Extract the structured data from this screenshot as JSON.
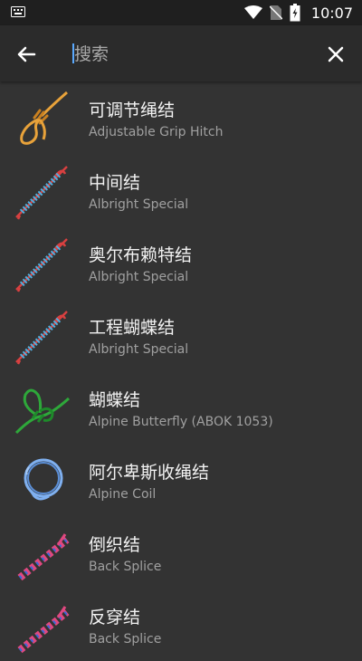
{
  "status_bar": {
    "time": "10:07"
  },
  "search": {
    "placeholder": "搜索",
    "value": ""
  },
  "knots": [
    {
      "name": "可调节绳结",
      "subtitle": "Adjustable Grip Hitch",
      "icon": "orange-knot-icon",
      "color": "#e8a23a"
    },
    {
      "name": "中间结",
      "subtitle": "Albright Special",
      "icon": "blue-red-coil-knot-icon",
      "color": "#5ab4e6"
    },
    {
      "name": "奥尔布赖特结",
      "subtitle": "Albright Special",
      "icon": "blue-red-coil-knot-icon",
      "color": "#5ab4e6"
    },
    {
      "name": "工程蝴蝶结",
      "subtitle": "Albright Special",
      "icon": "blue-red-coil-knot-icon",
      "color": "#5ab4e6"
    },
    {
      "name": "蝴蝶结",
      "subtitle": "Alpine Butterfly (ABOK 1053)",
      "icon": "green-butterfly-knot-icon",
      "color": "#2ea83a"
    },
    {
      "name": "阿尔卑斯收绳结",
      "subtitle": "Alpine Coil",
      "icon": "blue-coil-icon",
      "color": "#7fb0f0"
    },
    {
      "name": "倒织结",
      "subtitle": "Back Splice",
      "icon": "pink-blue-splice-icon",
      "color": "#e04880"
    },
    {
      "name": "反穿结",
      "subtitle": "Back Splice",
      "icon": "pink-blue-splice-icon",
      "color": "#e04880"
    }
  ]
}
